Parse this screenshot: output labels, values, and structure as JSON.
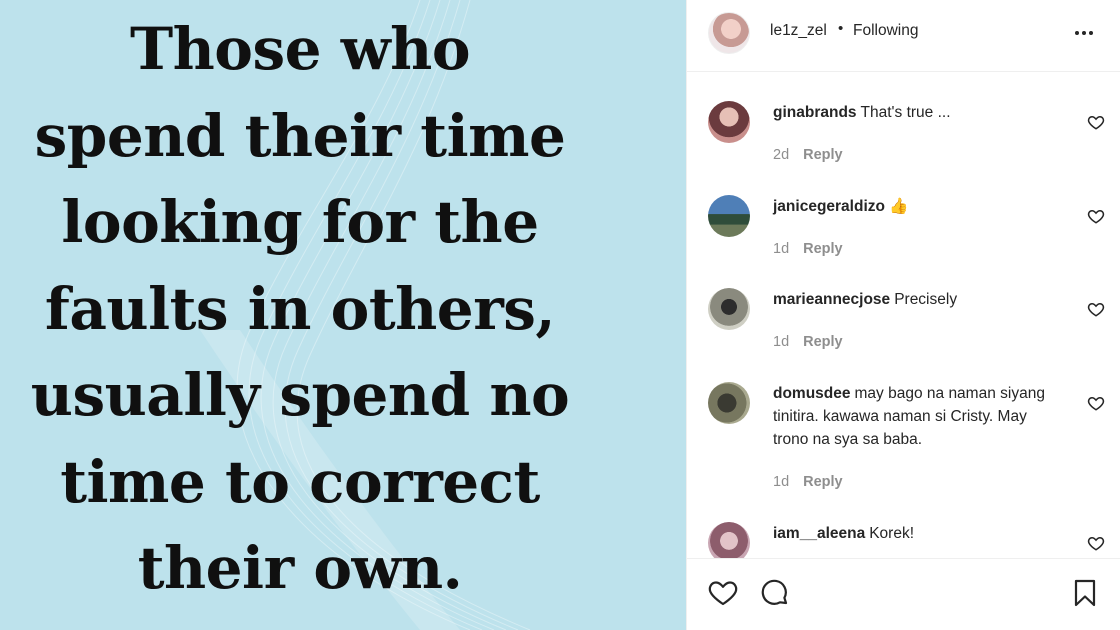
{
  "post": {
    "quote_lines": [
      "Those who",
      "spend their time",
      "looking for the",
      "faults in others,",
      "usually spend no",
      "time to correct",
      "their own."
    ],
    "background_color": "#bde2ec"
  },
  "header": {
    "username": "le1z_zel",
    "separator": "•",
    "follow_status": "Following",
    "more_icon": "more-horizontal-icon"
  },
  "comments": [
    {
      "username": "ginabrands",
      "text": "That's true ...",
      "age": "2d",
      "reply_label": "Reply"
    },
    {
      "username": "janicegeraldizo",
      "text": "👍",
      "age": "1d",
      "reply_label": "Reply"
    },
    {
      "username": "marieannecjose",
      "text": "Precisely",
      "age": "1d",
      "reply_label": "Reply"
    },
    {
      "username": "domusdee",
      "text": "may bago na naman siyang tinitira. kawawa naman si Cristy. May trono na sya sa baba.",
      "age": "1d",
      "reply_label": "Reply"
    },
    {
      "username": "iam__aleena",
      "text": "Korek!",
      "age": "",
      "reply_label": ""
    }
  ],
  "actions": {
    "like_icon": "heart-icon",
    "comment_icon": "comment-icon",
    "save_icon": "bookmark-icon"
  }
}
